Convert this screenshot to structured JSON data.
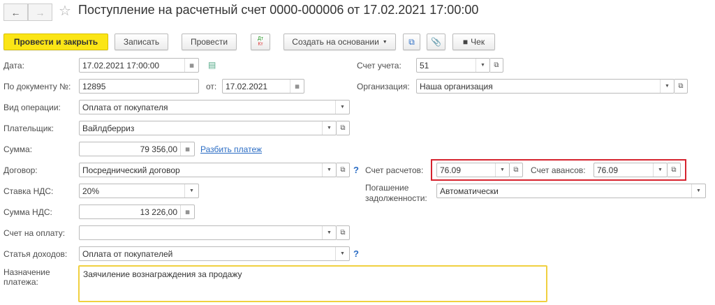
{
  "window": {
    "title": "Поступление на расчетный счет 0000-000006 от 17.02.2021 17:00:00",
    "back": "←",
    "forward": "→",
    "star": "☆"
  },
  "toolbar": {
    "post_close": "Провести и закрыть",
    "save": "Записать",
    "post": "Провести",
    "dtkt_top": "Дт",
    "dtkt_bottom": "Кт",
    "create_based": "Создать на основании",
    "receipt": "Чек"
  },
  "form": {
    "date": {
      "label": "Дата:",
      "value": "17.02.2021 17:00:00"
    },
    "account": {
      "label": "Счет учета:",
      "value": "51"
    },
    "doc_no": {
      "label": "По документу №:",
      "value": "12895",
      "from_label": "от:",
      "from_value": "17.02.2021"
    },
    "org": {
      "label": "Организация:",
      "value": "Наша организация"
    },
    "op_type": {
      "label": "Вид операции:",
      "value": "Оплата от покупателя"
    },
    "payer": {
      "label": "Плательщик:",
      "value": "Вайлдберриз"
    },
    "sum": {
      "label": "Сумма:",
      "value": "79 356,00",
      "split_link": "Разбить платеж"
    },
    "contract": {
      "label": "Договор:",
      "value": "Посреднический договор",
      "help": "?"
    },
    "settle_acc": {
      "label": "Счет расчетов:",
      "value": "76.09"
    },
    "adv_acc": {
      "label": "Счет авансов:",
      "value": "76.09"
    },
    "vat_rate": {
      "label": "Ставка НДС:",
      "value": "20%"
    },
    "repayment": {
      "label1": "Погашение",
      "label2": "задолженности:",
      "value": "Автоматически"
    },
    "vat_sum": {
      "label": "Сумма НДС:",
      "value": "13 226,00"
    },
    "invoice": {
      "label": "Счет на оплату:",
      "value": ""
    },
    "income": {
      "label": "Статья доходов:",
      "value": "Оплата от покупателей",
      "help": "?"
    },
    "purpose": {
      "label1": "Назначение",
      "label2": "платежа:",
      "value": "Заячиление вознаграждения за продажу"
    }
  }
}
